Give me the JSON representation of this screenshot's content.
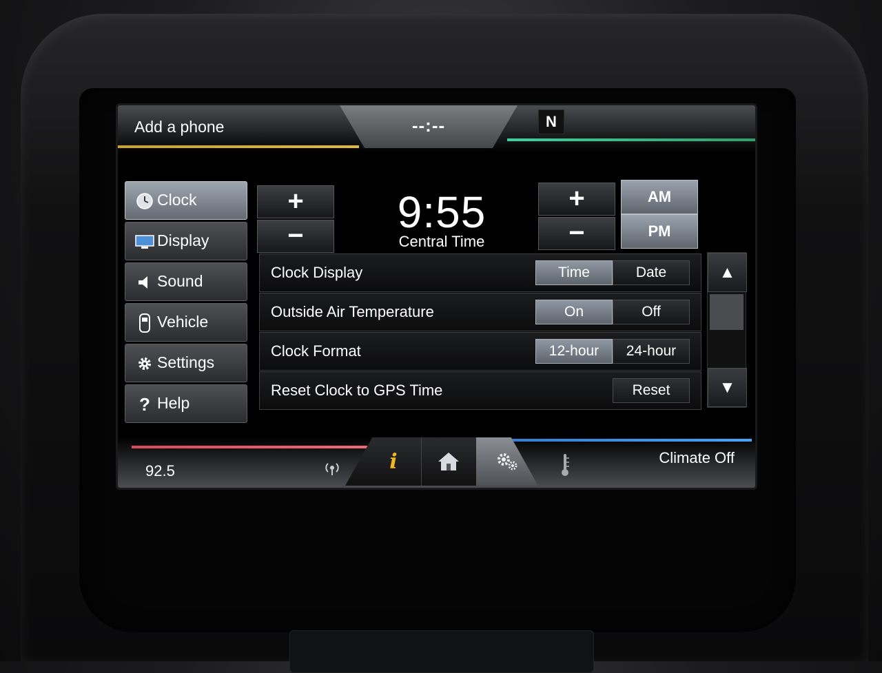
{
  "status_bar": {
    "phone_label": "Add a phone",
    "clock_display": "--:--",
    "compass": "N"
  },
  "menu": {
    "items": [
      {
        "label": "Clock",
        "icon": "clock-icon",
        "active": true
      },
      {
        "label": "Display",
        "icon": "display-icon",
        "active": false
      },
      {
        "label": "Sound",
        "icon": "speaker-icon",
        "active": false
      },
      {
        "label": "Vehicle",
        "icon": "vehicle-icon",
        "active": false
      },
      {
        "label": "Settings",
        "icon": "gear-icon",
        "active": false
      },
      {
        "label": "Help",
        "icon": "help-icon",
        "active": false
      }
    ]
  },
  "clock": {
    "time": "9:55",
    "zone": "Central Time",
    "hour_plus": "+",
    "hour_minus": "−",
    "minute_plus": "+",
    "minute_minus": "−",
    "am": "AM",
    "pm": "PM",
    "selected_period": "PM"
  },
  "settings": {
    "rows": [
      {
        "label": "Clock Display",
        "options": [
          "Time",
          "Date"
        ],
        "selected": "Time"
      },
      {
        "label": "Outside Air Temperature",
        "options": [
          "On",
          "Off"
        ],
        "selected": "On"
      },
      {
        "label": "Clock Format",
        "options": [
          "12-hour",
          "24-hour"
        ],
        "selected": "12-hour"
      },
      {
        "label": "Reset Clock to GPS Time",
        "button": "Reset"
      }
    ]
  },
  "scrollbar": {
    "up": "▲",
    "down": "▼"
  },
  "bottom_bar": {
    "radio": "92.5",
    "climate": "Climate Off",
    "tabs": [
      "info-icon",
      "home-icon",
      "settings-icon"
    ],
    "active_tab": "settings-icon"
  },
  "colors": {
    "phone_accent": "#c9a227",
    "nav_accent": "#3bd3a0",
    "entertainment_accent": "#d94a5c",
    "climate_accent": "#3fa7ff",
    "info_icon": "#f2b620"
  }
}
